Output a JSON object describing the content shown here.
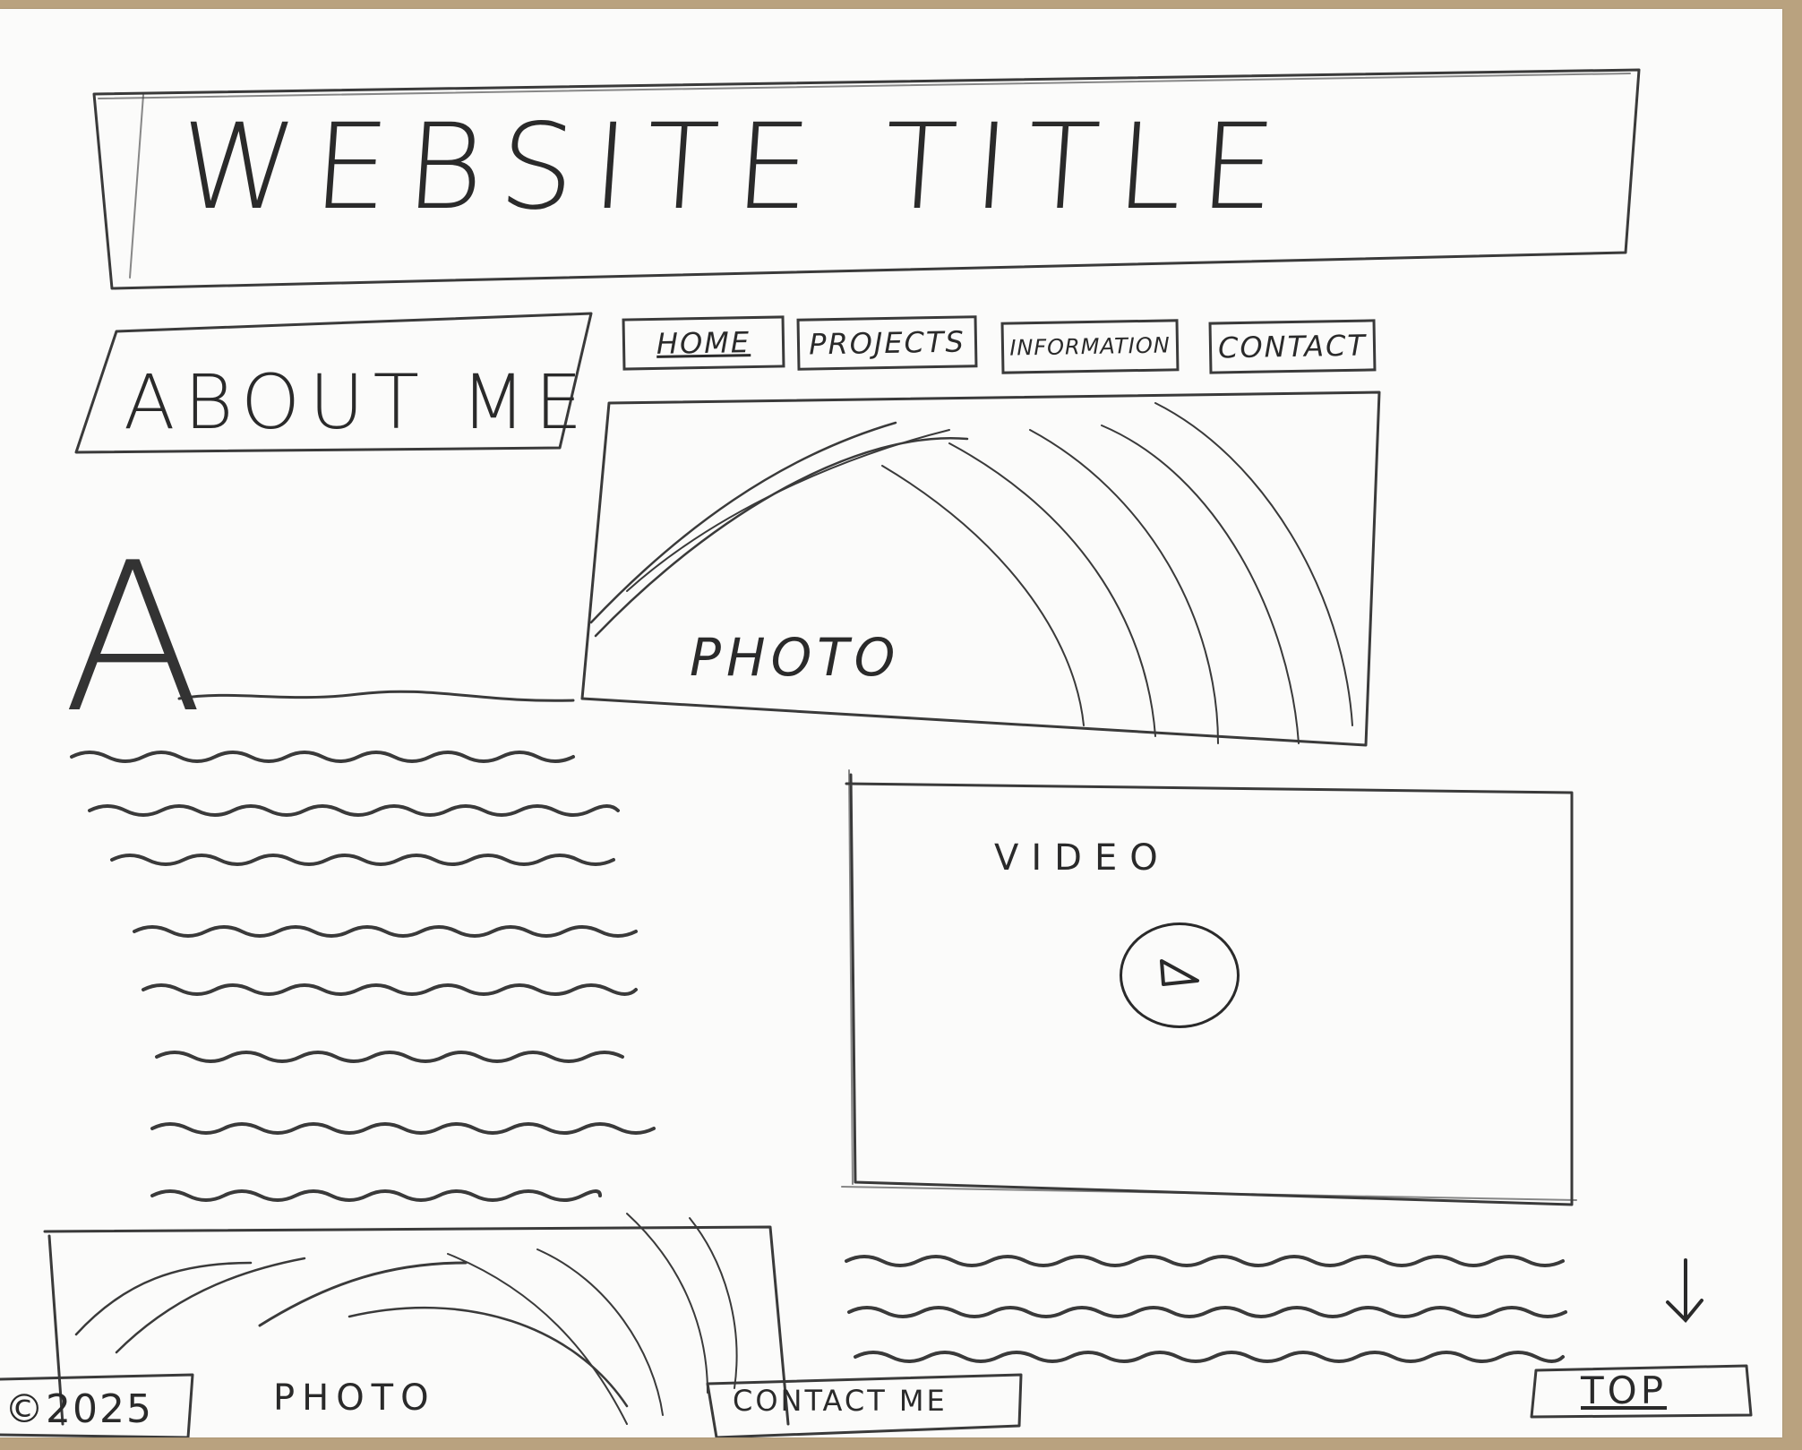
{
  "header": {
    "title": "WEBSITE TITLE"
  },
  "sidebar": {
    "heading": "ABOUT ME",
    "drop_cap": "A"
  },
  "nav": {
    "items": [
      {
        "label": "HOME"
      },
      {
        "label": "PROJECTS"
      },
      {
        "label": "INFORMATION"
      },
      {
        "label": "CONTACT"
      }
    ]
  },
  "main": {
    "photo_label": "PHOTO",
    "video_label": "VIDEO",
    "bottom_photo_label": "PHOTO"
  },
  "footer": {
    "copyright": "©2025",
    "contact_label": "CONTACT ME",
    "top_label": "TOP"
  },
  "icons": {
    "play": "play-icon",
    "scroll_down": "arrow-down-icon"
  },
  "colors": {
    "pencil": "#2a2a2a",
    "paper": "#fbfbfa",
    "background": "#b9a27f"
  }
}
